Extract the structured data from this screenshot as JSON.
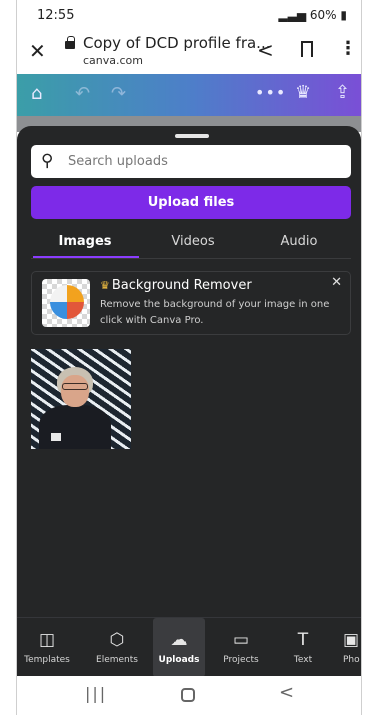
{
  "status_bar": {
    "time": "12:55",
    "indicators": "60%"
  },
  "browser": {
    "close_icon": "✕",
    "tab_title": "Copy of DCD profile fra...",
    "url": "canva.com"
  },
  "canva_toolbar": {
    "icons": [
      "home-icon",
      "undo-icon",
      "redo-icon",
      "more-icon",
      "crown-icon",
      "share-upload-icon"
    ]
  },
  "panel": {
    "search": {
      "placeholder": "Search uploads"
    },
    "upload_button": "Upload files",
    "tabs": [
      {
        "label": "Images",
        "active": true
      },
      {
        "label": "Videos",
        "active": false
      },
      {
        "label": "Audio",
        "active": false
      }
    ],
    "promo": {
      "title": "Background Remover",
      "description": "Remove the background of your image in one click with Canva Pro."
    }
  },
  "bottom_nav": [
    {
      "label": "Templates",
      "icon": "templates-icon"
    },
    {
      "label": "Elements",
      "icon": "elements-icon"
    },
    {
      "label": "Uploads",
      "icon": "uploads-icon",
      "active": true
    },
    {
      "label": "Projects",
      "icon": "projects-icon"
    },
    {
      "label": "Text",
      "icon": "text-icon"
    },
    {
      "label": "Pho",
      "icon": "photos-icon"
    }
  ],
  "colors": {
    "accent": "#7d2ae8",
    "panel_bg": "#252627",
    "tab_underline": "#8b3dff"
  }
}
